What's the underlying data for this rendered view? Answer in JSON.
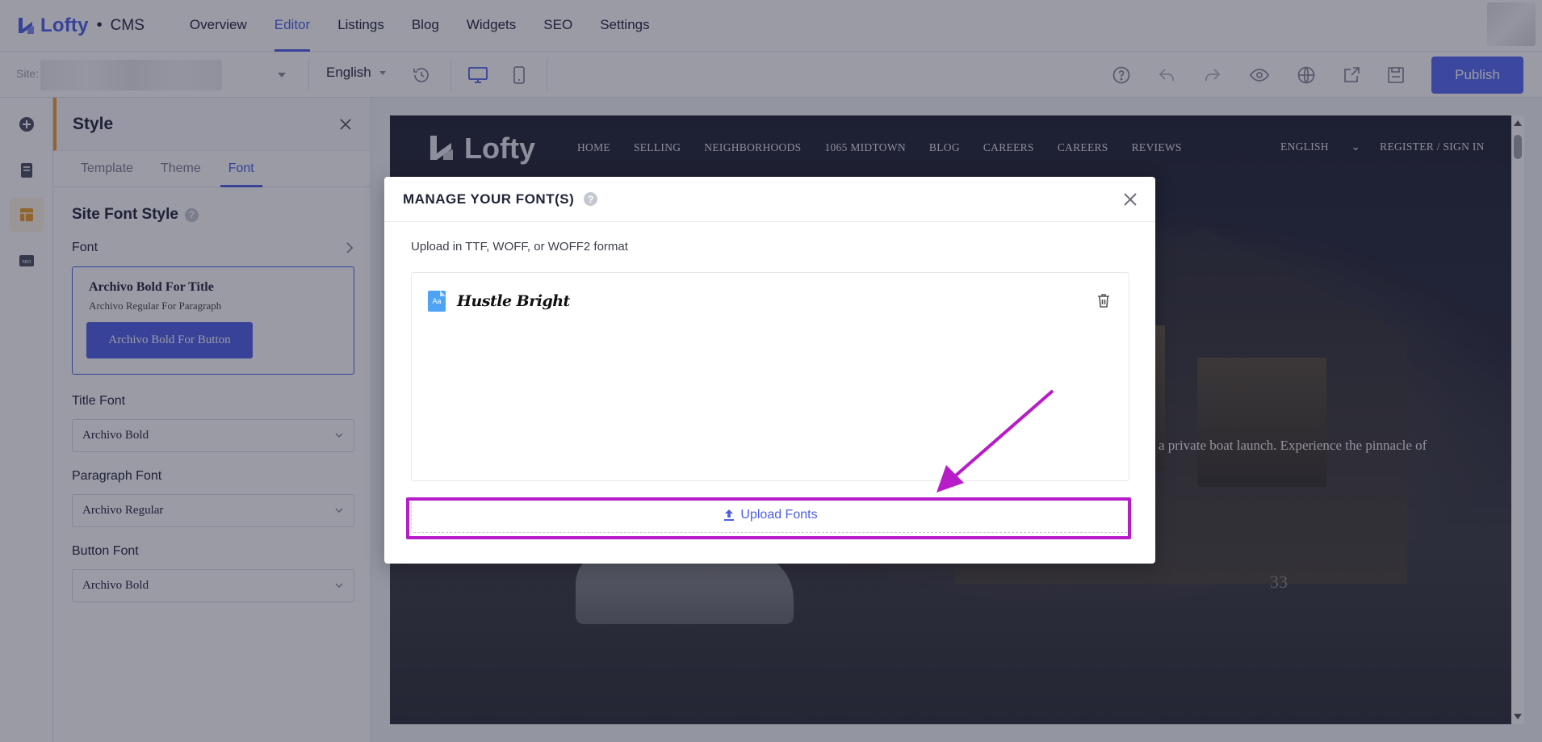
{
  "app": {
    "brand": "Lofty",
    "separator": "•",
    "section": "CMS"
  },
  "topnav": {
    "items": [
      "Overview",
      "Editor",
      "Listings",
      "Blog",
      "Widgets",
      "SEO",
      "Settings"
    ],
    "active": "Editor"
  },
  "toolbar": {
    "site_label": "Site:",
    "language": "English",
    "publish_label": "Publish"
  },
  "style_panel": {
    "title": "Style",
    "tabs": [
      "Template",
      "Theme",
      "Font"
    ],
    "active_tab": "Font",
    "section_title": "Site Font Style",
    "font_row_label": "Font",
    "preview": {
      "title": "Archivo Bold For Title",
      "paragraph": "Archivo Regular For Paragraph",
      "button": "Archivo Bold For Button"
    },
    "title_font": {
      "label": "Title Font",
      "value": "Archivo Bold"
    },
    "paragraph_font": {
      "label": "Paragraph Font",
      "value": "Archivo Regular"
    },
    "button_font": {
      "label": "Button Font",
      "value": "Archivo Bold"
    }
  },
  "preview_site": {
    "logo": "Lofty",
    "nav": [
      "HOME",
      "SELLING",
      "NEIGHBORHOODS",
      "1065 MIDTOWN",
      "BLOG",
      "CAREERS",
      "CAREERS",
      "REVIEWS"
    ],
    "language": "ENGLISH",
    "auth": "REGISTER / SIGN IN",
    "hero_text": "a private boat launch. Experience the pinnacle of",
    "house_number": "33"
  },
  "modal": {
    "title": "MANAGE YOUR FONT(S)",
    "hint": "Upload in TTF, WOFF, or WOFF2 format",
    "fonts": [
      {
        "icon_text": "Aa",
        "name": "Hustle Bright"
      }
    ],
    "upload_label": "Upload Fonts"
  },
  "colors": {
    "accent": "#4b5ee8",
    "highlight": "#b61cc8",
    "sidebar_active": "#f19b26"
  }
}
